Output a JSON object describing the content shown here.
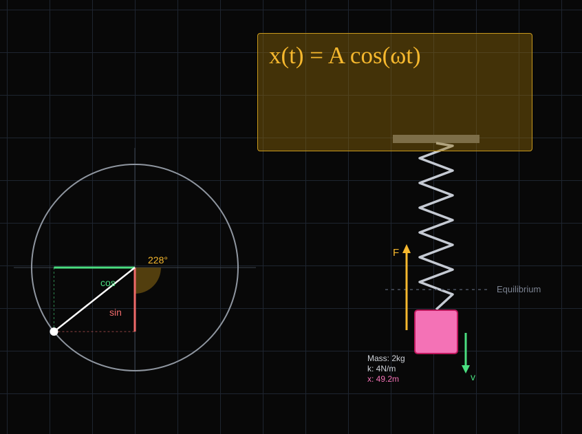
{
  "formula": {
    "text": "x(t) = A cos(ωt)"
  },
  "unit_circle": {
    "angle_deg": 228,
    "angle_label": "228°",
    "cos_label": "cos",
    "sin_label": "sin"
  },
  "spring": {
    "force_label": "F",
    "velocity_label": "v",
    "equilibrium_label": "Equilibrium"
  },
  "info": {
    "mass": "Mass: 2kg",
    "k": "k: 4N/m",
    "x": "x: 49.2m"
  },
  "colors": {
    "circle": "#8f96a0",
    "radius": "#ffffff",
    "cos": "#4ade80",
    "sin": "#f06a6a",
    "angle": "#f6b82e",
    "force": "#f6b82e",
    "velocity": "#4ade80",
    "mass_block": "#f472b6",
    "spring": "#c5cad3",
    "formula": "#f6b82e"
  }
}
